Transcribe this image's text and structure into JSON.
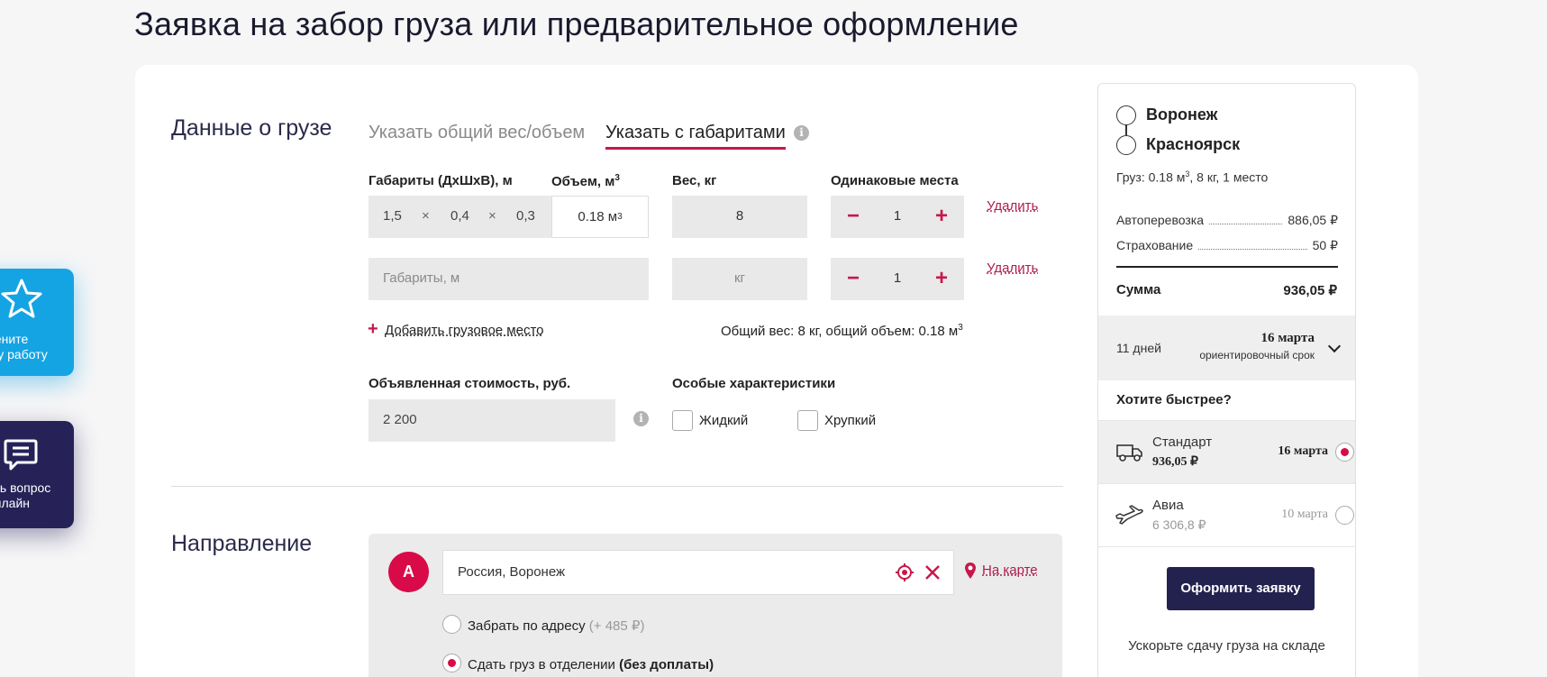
{
  "page": {
    "title": "Заявка на забор груза или предварительное оформление"
  },
  "cargo": {
    "section_title": "Данные о грузе",
    "tabs": [
      {
        "label": "Указать общий вес/объем",
        "active": false
      },
      {
        "label": "Указать с габаритами",
        "active": true
      }
    ],
    "columns": {
      "dims": "Габариты (ДхШхВ), м",
      "volume": "Объем, м",
      "volume_sup": "3",
      "weight": "Вес, кг",
      "same_places": "Одинаковые места"
    },
    "rows": [
      {
        "length": "1,5",
        "width": "0,4",
        "height": "0,3",
        "times": "×",
        "volume": "0.18 м",
        "volume_sup": "3",
        "weight": "8",
        "count": "1",
        "delete": "Удалить"
      },
      {
        "dims_placeholder": "Габариты, м",
        "weight_placeholder": "кг",
        "count": "1",
        "delete": "Удалить"
      }
    ],
    "stepper": {
      "minus": "−",
      "plus": "+"
    },
    "add_place": "Добавить грузовое место",
    "add_icon": "plus-icon",
    "total": "Общий вес: 8 кг, общий объем: 0.18 м",
    "total_sup": "3",
    "declared_label": "Объявленная стоимость, руб.",
    "declared_value": "2 200",
    "special_label": "Особые характеристики",
    "special": [
      {
        "label": "Жидкий",
        "checked": false
      },
      {
        "label": "Хрупкий",
        "checked": false
      }
    ],
    "info_glyph": "i"
  },
  "direction": {
    "section_title": "Направление",
    "pin_letter": "А",
    "address": "Россия, Воронеж",
    "map_link": "На карте",
    "options": [
      {
        "label": "Забрать по адресу",
        "extra": "(+ 485 ₽)",
        "selected": false
      },
      {
        "label": "Сдать груз в отделении",
        "extra": "(без доплаты)",
        "selected": true
      }
    ]
  },
  "summary": {
    "from_city": "Воронеж",
    "to_city": "Красноярск",
    "cargo_line": "Груз: 0.18 м",
    "cargo_sup": "3",
    "cargo_rest": ", 8 кг, 1 место",
    "lines": [
      {
        "label": "Автоперевозка",
        "value": "886,05 ₽"
      },
      {
        "label": "Страхование",
        "value": "50 ₽"
      }
    ],
    "total_label": "Сумма",
    "total_value": "936,05 ₽",
    "days": "11 дней",
    "date": "16 марта",
    "date_note": "ориентировочный срок",
    "faster_title": "Хотите быстрее?",
    "options": [
      {
        "name": "Стандарт",
        "price": "936,05 ₽",
        "date": "16 марта",
        "selected": true,
        "icon": "truck-icon"
      },
      {
        "name": "Авиа",
        "price": "6 306,8 ₽",
        "date": "10 марта",
        "selected": false,
        "icon": "plane-icon"
      }
    ],
    "order_button": "Оформить заявку",
    "footer": "Ускорьте сдачу груза на складе"
  },
  "widgets": {
    "rate_text": "цените\nшу работу",
    "ask_text": "ать вопрос\nонлайн"
  },
  "colors": {
    "accent": "#c8174b",
    "brand_dark": "#23224f",
    "widget_blue": "#14a4e3"
  }
}
